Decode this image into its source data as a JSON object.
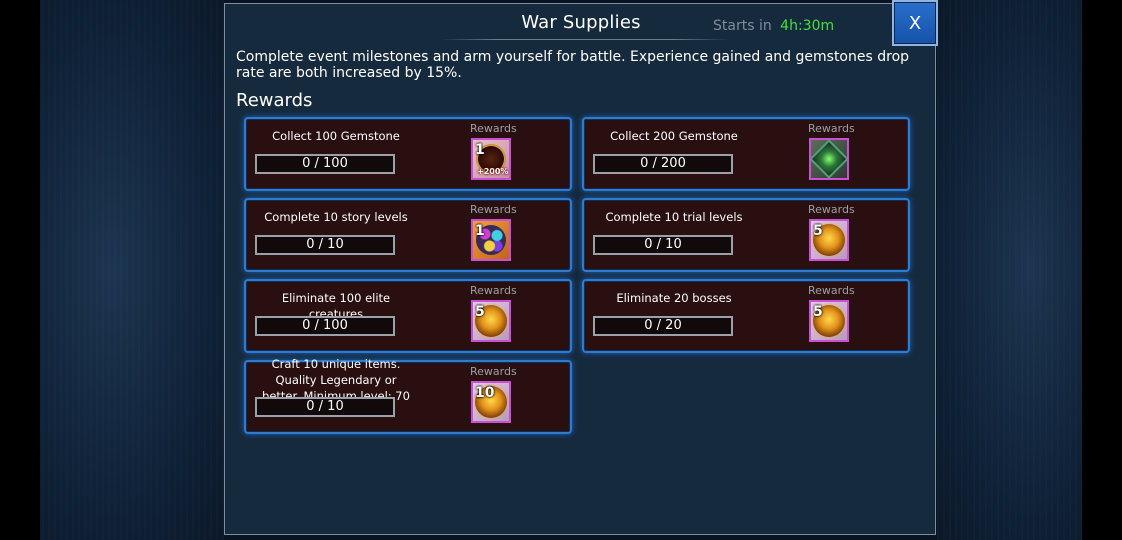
{
  "header": {
    "title": "War Supplies",
    "starts_label": "Starts in",
    "starts_time": "4h:30m",
    "close_label": "X"
  },
  "description": "Complete event milestones and arm yourself for battle. Experience gained and gemstones drop rate are both increased by 15%.",
  "rewards_heading": "Rewards",
  "colors": {
    "accent_green": "#3fe23a",
    "card_border": "#2e7bd1",
    "card_background": "#2a0f10",
    "close_button": "#1f5fbf"
  },
  "milestones": [
    {
      "title": "Collect 100 Gemstone",
      "progress": "0 / 100",
      "reward_label": "Rewards",
      "reward": {
        "icon": "gemstone-boost-emblem-icon",
        "qty": "1",
        "badge": "+200%"
      }
    },
    {
      "title": "Collect 200 Gemstone",
      "progress": "0 / 200",
      "reward_label": "Rewards",
      "reward": {
        "icon": "green-cube-icon",
        "qty": "",
        "badge": ""
      }
    },
    {
      "title": "Complete 10 story levels",
      "progress": "0 / 10",
      "reward_label": "Rewards",
      "reward": {
        "icon": "gem-pile-icon",
        "qty": "1",
        "badge": ""
      }
    },
    {
      "title": "Complete 10 trial levels",
      "progress": "0 / 10",
      "reward_label": "Rewards",
      "reward": {
        "icon": "gold-orb-icon",
        "qty": "5",
        "badge": ""
      }
    },
    {
      "title": "Eliminate 100 elite creatures",
      "progress": "0 / 100",
      "reward_label": "Rewards",
      "reward": {
        "icon": "gold-orb-icon",
        "qty": "5",
        "badge": ""
      }
    },
    {
      "title": "Eliminate 20 bosses",
      "progress": "0 / 20",
      "reward_label": "Rewards",
      "reward": {
        "icon": "gold-orb-icon",
        "qty": "5",
        "badge": ""
      }
    },
    {
      "title": "Craft 10 unique items. Quality Legendary or better. Minimum level: 70",
      "progress": "0 / 10",
      "reward_label": "Rewards",
      "reward": {
        "icon": "gold-orb-icon",
        "qty": "10",
        "badge": ""
      }
    }
  ]
}
